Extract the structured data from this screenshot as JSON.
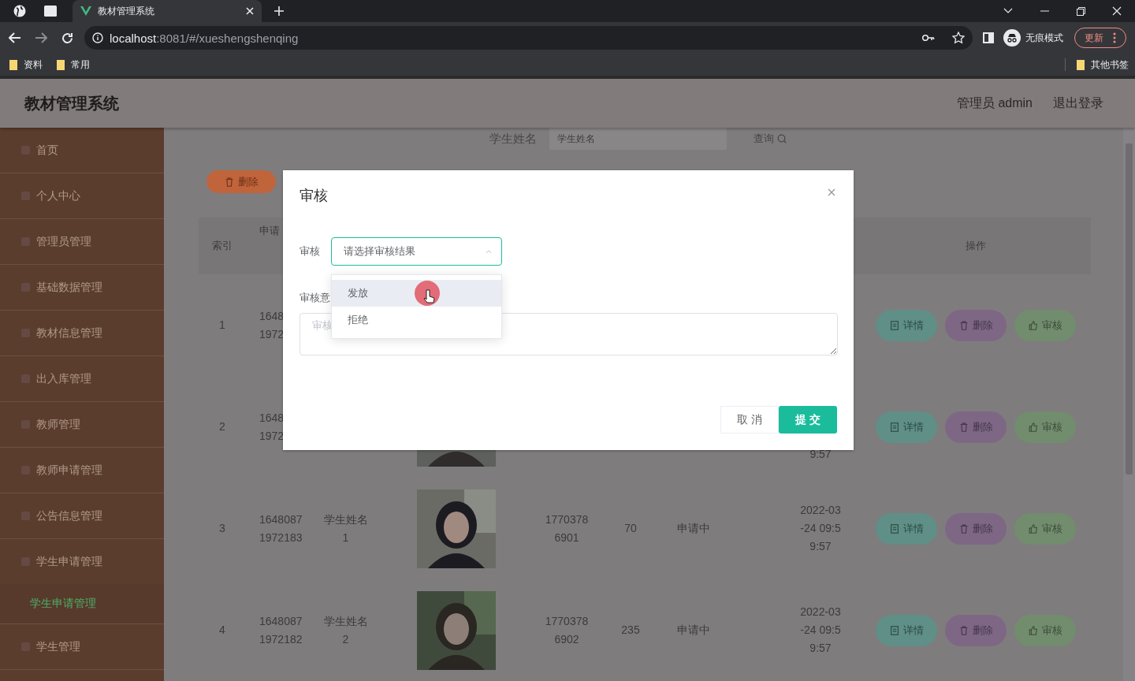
{
  "browser": {
    "tab_title": "教材管理系统",
    "url_host": "localhost",
    "url_path": ":8081/#/xueshengshenqing",
    "profile_label": "无痕模式",
    "update_button": "更新",
    "bookmarks": [
      "资料",
      "常用"
    ],
    "other_bookmarks": "其他书签"
  },
  "header": {
    "title": "教材管理系统",
    "user": "管理员 admin",
    "logout": "退出登录"
  },
  "sidebar": {
    "items": [
      {
        "label": "首页",
        "selected": false
      },
      {
        "label": "个人中心",
        "selected": false
      },
      {
        "label": "管理员管理",
        "selected": false
      },
      {
        "label": "基础数据管理",
        "selected": false
      },
      {
        "label": "教材信息管理",
        "selected": false
      },
      {
        "label": "出入库管理",
        "selected": false
      },
      {
        "label": "教师管理",
        "selected": false
      },
      {
        "label": "教师申请管理",
        "selected": false
      },
      {
        "label": "公告信息管理",
        "selected": false
      },
      {
        "label": "学生申请管理",
        "selected": false,
        "expanded": true,
        "children": [
          {
            "label": "学生申请管理",
            "selected": true
          }
        ]
      },
      {
        "label": "学生管理",
        "selected": false
      }
    ]
  },
  "search": {
    "label": "学生姓名",
    "placeholder": "学生姓名",
    "button": "查询"
  },
  "delete_button": "删除",
  "table": {
    "header": {
      "index": "索引",
      "number": "申请",
      "actions": "操作"
    },
    "rows": [
      {
        "index": "1",
        "number": [
          "1648",
          "1972"
        ],
        "actions": [
          {
            "kind": "detail",
            "label": "详情"
          },
          {
            "kind": "delete",
            "label": "删除"
          },
          {
            "kind": "review",
            "label": "审核"
          }
        ]
      },
      {
        "index": "2",
        "number": [
          "1648",
          "1972"
        ],
        "photo": {
          "kind": "picture"
        },
        "time": [
          "9:57"
        ],
        "actions": [
          {
            "kind": "detail",
            "label": "详情"
          },
          {
            "kind": "delete",
            "label": "删除"
          },
          {
            "kind": "review",
            "label": "审核"
          }
        ]
      },
      {
        "index": "3",
        "number": [
          "1648087",
          "1972183"
        ],
        "name": [
          "学生姓名",
          "1"
        ],
        "photo": {
          "kind": "picture"
        },
        "phone": [
          "1770378",
          "6901"
        ],
        "quantity": "70",
        "status": "申请中",
        "time": [
          "2022-03",
          "-24 09:5",
          "9:57"
        ],
        "actions": [
          {
            "kind": "detail",
            "label": "详情"
          },
          {
            "kind": "delete",
            "label": "删除"
          },
          {
            "kind": "review",
            "label": "审核"
          }
        ]
      },
      {
        "index": "4",
        "number": [
          "1648087",
          "1972182"
        ],
        "name": [
          "学生姓名",
          "2"
        ],
        "photo": {
          "kind": "picture"
        },
        "phone": [
          "1770378",
          "6902"
        ],
        "quantity": "235",
        "status": "申请中",
        "time": [
          "2022-03",
          "-24 09:5",
          "9:57"
        ],
        "actions": [
          {
            "kind": "detail",
            "label": "详情"
          },
          {
            "kind": "delete",
            "label": "删除"
          },
          {
            "kind": "review",
            "label": "审核"
          }
        ]
      }
    ]
  },
  "dialog": {
    "title": "审核",
    "review_label": "审核",
    "select_placeholder": "请选择审核结果",
    "opinion_label": "审核意",
    "opinion_placeholder": "审核",
    "options": [
      {
        "label": "发放",
        "hovered": true
      },
      {
        "label": "拒绝",
        "hovered": false
      }
    ],
    "cancel": "取 消",
    "submit": "提 交"
  }
}
